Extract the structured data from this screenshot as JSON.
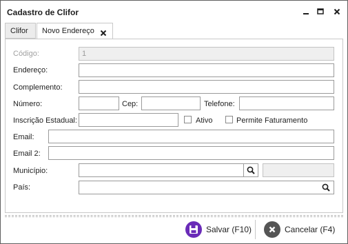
{
  "window": {
    "title": "Cadastro de Clifor",
    "controls": [
      "minimize-icon",
      "maximize-icon",
      "close-icon"
    ]
  },
  "tabs": [
    {
      "label": "Clifor",
      "active": false
    },
    {
      "label": "Novo Endereço",
      "active": true,
      "closable": true
    }
  ],
  "form": {
    "codigo": {
      "label": "Código:",
      "value": "1",
      "disabled": true
    },
    "endereco": {
      "label": "Endereço:",
      "value": ""
    },
    "complemento": {
      "label": "Complemento:",
      "value": ""
    },
    "numero": {
      "label": "Número:",
      "value": ""
    },
    "cep": {
      "label": "Cep:",
      "value": ""
    },
    "telefone": {
      "label": "Telefone:",
      "value": ""
    },
    "inscricao": {
      "label": "Inscrição Estadual:",
      "value": ""
    },
    "ativo": {
      "label": "Ativo",
      "checked": false
    },
    "permite_faturamento": {
      "label": "Permite Faturamento",
      "checked": false
    },
    "email": {
      "label": "Email:",
      "value": ""
    },
    "email2": {
      "label": "Email 2:",
      "value": ""
    },
    "municipio": {
      "label": "Município:",
      "value": "",
      "aux_value": ""
    },
    "pais": {
      "label": "País:",
      "value": ""
    }
  },
  "footer": {
    "save_label": "Salvar (F10)",
    "cancel_label": "Cancelar (F4)"
  },
  "colors": {
    "save_icon": "#6a2bb8",
    "cancel_icon": "#555555",
    "border": "#9a9a9a",
    "disabled_bg": "#efefef"
  }
}
